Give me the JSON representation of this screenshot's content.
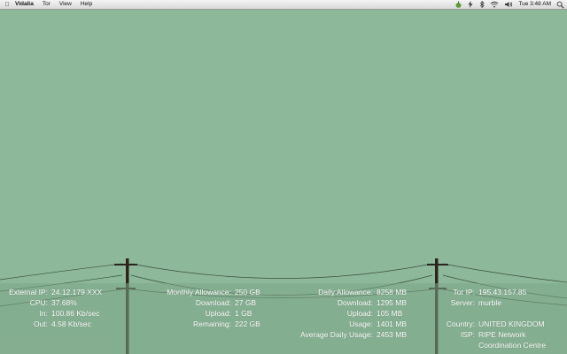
{
  "menubar": {
    "app_name": "Vidalia",
    "menus": [
      "Tor",
      "View",
      "Help"
    ],
    "clock": "Tue 3:48 AM"
  },
  "stats": {
    "network": [
      {
        "label": "External IP:",
        "value": "24.12.179.XXX"
      },
      {
        "label": "CPU:",
        "value": "37.68%"
      },
      {
        "label": "In:",
        "value": "100.86 Kb/sec"
      },
      {
        "label": "Out:",
        "value": "4.58 Kb/sec"
      }
    ],
    "monthly": [
      {
        "label": "Monthly Allowance:",
        "value": "250 GB"
      },
      {
        "label": "Download:",
        "value": "27 GB"
      },
      {
        "label": "Upload:",
        "value": "1 GB"
      },
      {
        "label": "Remaining:",
        "value": "222 GB"
      }
    ],
    "daily": [
      {
        "label": "Daily Allowance:",
        "value": "8258 MB"
      },
      {
        "label": "Download:",
        "value": "1295 MB"
      },
      {
        "label": "Upload:",
        "value": "105 MB"
      },
      {
        "label": "Usage:",
        "value": "1401 MB"
      },
      {
        "label": "Average Daily Usage:",
        "value": "2453 MB"
      }
    ],
    "tor_top": [
      {
        "label": "Tor IP:",
        "value": "195.43.157.85"
      },
      {
        "label": "Server:",
        "value": "murble"
      }
    ],
    "tor_bottom": [
      {
        "label": "Country:",
        "value": "UNITED KINGDOM"
      },
      {
        "label": "ISP:",
        "value": "RIPE Network"
      },
      {
        "label": "",
        "value": "Coordination Centre"
      }
    ]
  }
}
